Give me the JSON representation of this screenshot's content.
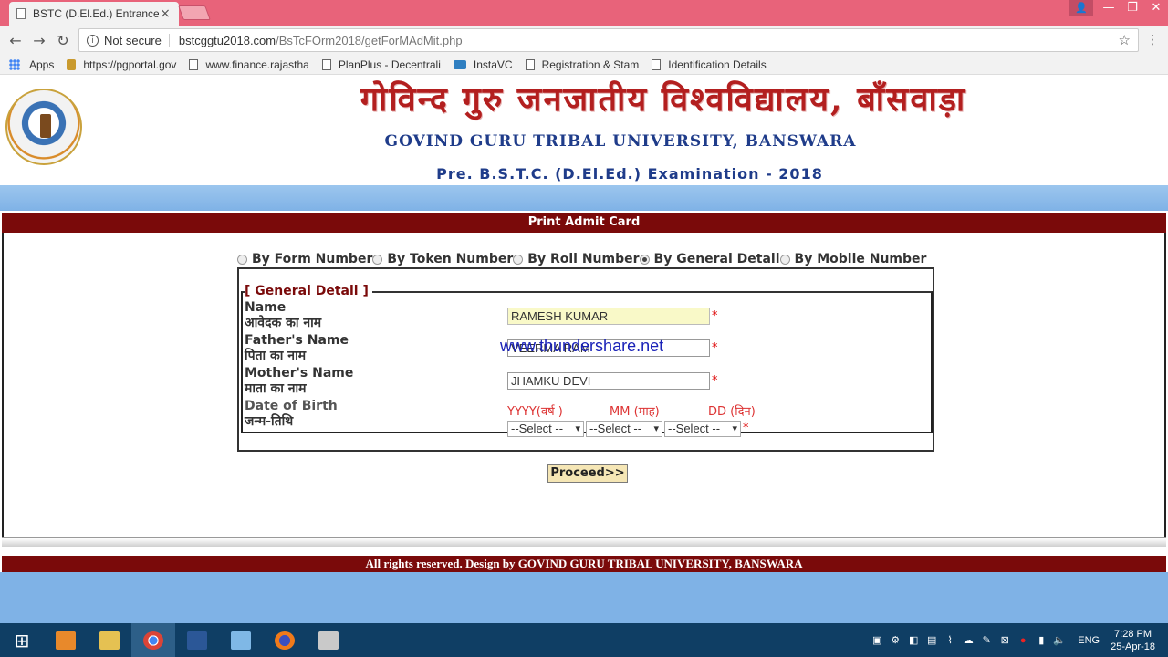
{
  "browser": {
    "tab_title": "BSTC (D.El.Ed.) Entrance E",
    "tab_close": "×",
    "nav": {
      "back": "←",
      "forward": "→",
      "reload": "↻"
    },
    "security_label": "Not secure",
    "url_host": "bstcggtu2018.com",
    "url_path": "/BsTcFOrm2018/getForMAdMit.php",
    "window_controls": {
      "minimize": "—",
      "maximize": "❐",
      "close": "✕"
    }
  },
  "bookmarks": [
    {
      "label": "Apps",
      "icon": "apps-icon"
    },
    {
      "label": "https://pgportal.gov",
      "icon": "gold-icon"
    },
    {
      "label": "www.finance.rajastha",
      "icon": "page-icon"
    },
    {
      "label": "PlanPlus - Decentrali",
      "icon": "page-icon"
    },
    {
      "label": "InstaVC",
      "icon": "camera-icon"
    },
    {
      "label": "Registration & Stam",
      "icon": "page-icon"
    },
    {
      "label": "Identification Details",
      "icon": "page-icon"
    }
  ],
  "header": {
    "hindi_title": "गोविन्द गुरु जनजातीय विश्वविद्यालय, बाँसवाड़ा",
    "english_title": "GOVIND GURU TRIBAL UNIVERSITY, BANSWARA",
    "exam_title": "Pre. B.S.T.C. (D.El.Ed.) Examination - 2018"
  },
  "section_title": "Print Admit Card",
  "search_options": [
    {
      "label": "By Form Number",
      "selected": false
    },
    {
      "label": "By Token Number",
      "selected": false
    },
    {
      "label": "By Roll Number",
      "selected": false
    },
    {
      "label": "By General Detail",
      "selected": true
    },
    {
      "label": "By Mobile Number",
      "selected": false
    }
  ],
  "form": {
    "legend": "[ General Detail ]",
    "name_label_en": "Name",
    "name_label_hi": "आवेदक का नाम",
    "name_value": "RAMESH KUMAR",
    "father_label_en": "Father's Name",
    "father_label_hi": "पिता का नाम",
    "father_value": "VEERMA RAM",
    "mother_label_en": "Mother's Name",
    "mother_label_hi": "माता का नाम",
    "mother_value": "JHAMKU DEVI",
    "dob_label_en": "Date of Birth",
    "dob_label_hi": "जन्म-तिथि",
    "dob_hint_year": "YYYY(वर्ष )",
    "dob_hint_month": "MM (माह)",
    "dob_hint_day": "DD (दिन)",
    "select_placeholder": "--Select --",
    "required_mark": "*"
  },
  "watermark": "www.thundershare.net",
  "proceed_label": "Proceed>>",
  "footer_text": "All rights reserved. Design by GOVIND GURU TRIBAL UNIVERSITY, BANSWARA",
  "taskbar": {
    "lang": "ENG",
    "time": "7:28 PM",
    "date": "25-Apr-18"
  }
}
